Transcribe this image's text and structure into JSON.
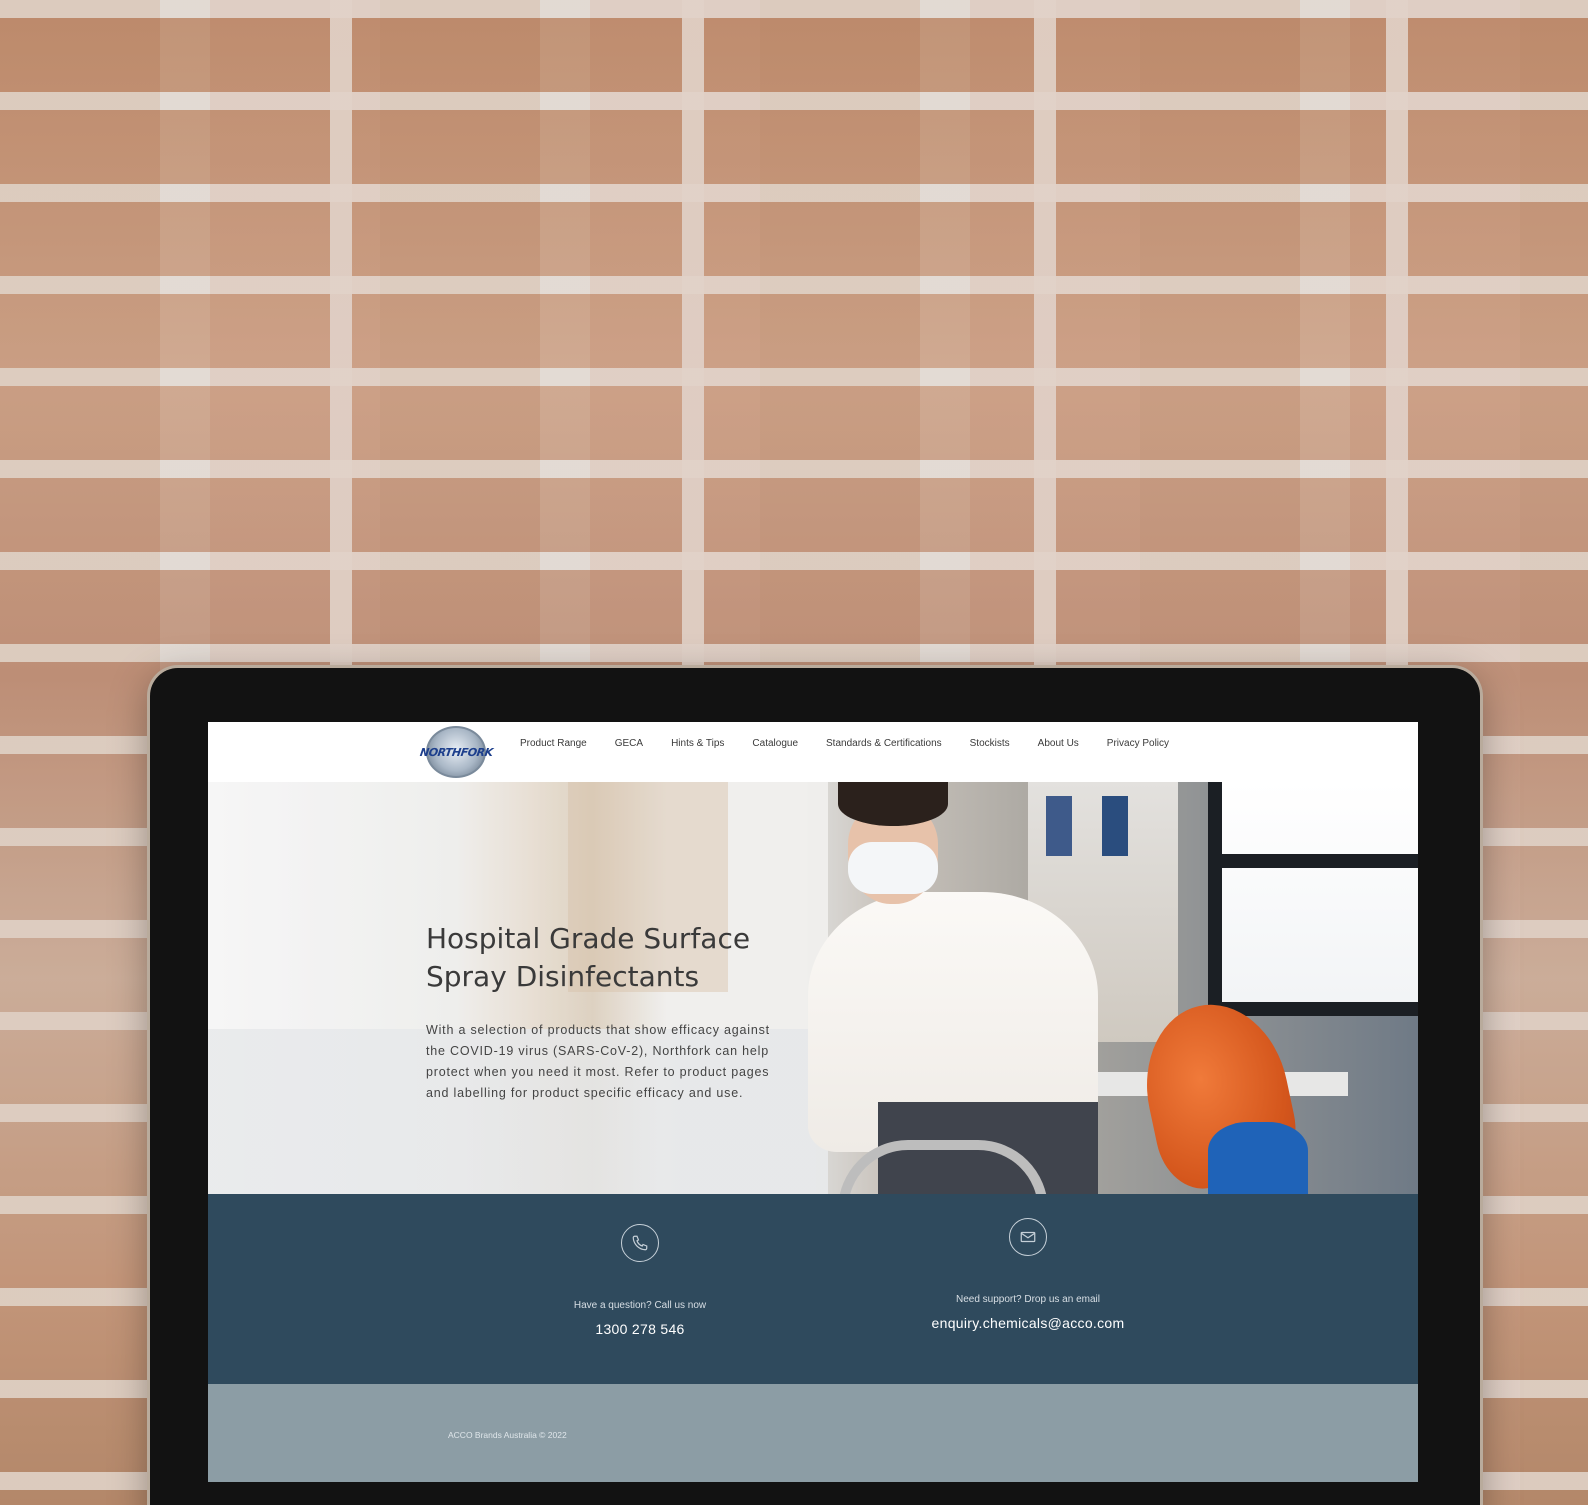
{
  "nav": {
    "logo_text": "NORTHFORK",
    "items": [
      {
        "label": "Product Range"
      },
      {
        "label": "GECA"
      },
      {
        "label": "Hints & Tips"
      },
      {
        "label": "Catalogue"
      },
      {
        "label": "Standards & Certifications"
      },
      {
        "label": "Stockists"
      },
      {
        "label": "About Us"
      },
      {
        "label": "Privacy Policy"
      }
    ]
  },
  "hero": {
    "title_line1": "Hospital Grade Surface",
    "title_line2": "Spray Disinfectants",
    "description": "With a selection of products that show efficacy against the COVID-19 virus (SARS-CoV-2), Northfork can help protect when you need it most. Refer to product pages and labelling for product specific efficacy and use."
  },
  "contact": {
    "phone": {
      "icon": "phone-icon",
      "label": "Have a question? Call us now",
      "value": "1300 278 546"
    },
    "email": {
      "icon": "envelope-icon",
      "label": "Need support? Drop us an email",
      "value": "enquiry.chemicals@acco.com"
    }
  },
  "footer": {
    "copyright": "ACCO Brands Australia © 2022"
  },
  "colors": {
    "contact_band": "#2f4a5d",
    "footer": "#8c9da5",
    "logo_blue": "#1d3f8c"
  }
}
